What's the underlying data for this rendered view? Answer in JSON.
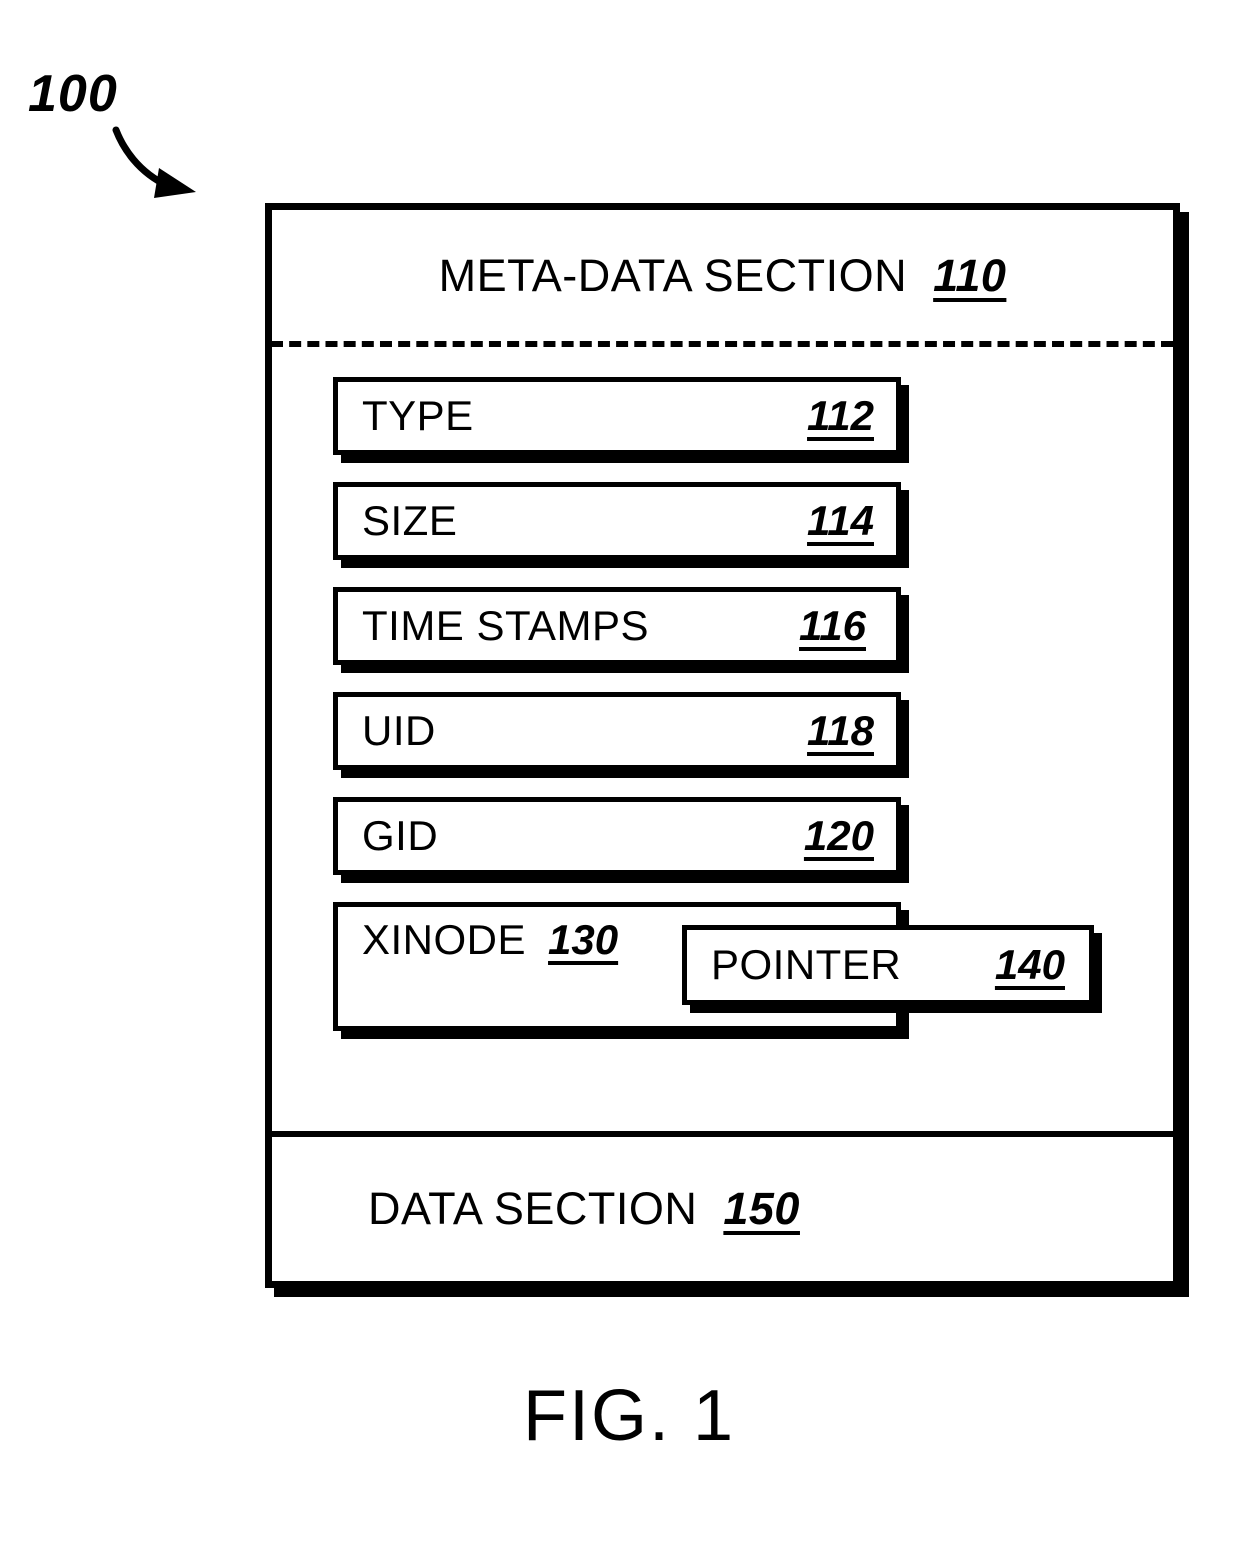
{
  "figure": {
    "callout_ref": "100",
    "caption": "FIG. 1"
  },
  "meta_section": {
    "title": "META-DATA SECTION",
    "ref": "110",
    "fields": [
      {
        "label": "TYPE",
        "ref": "112"
      },
      {
        "label": "SIZE",
        "ref": "114"
      },
      {
        "label": "TIME STAMPS",
        "ref": "116"
      },
      {
        "label": "UID",
        "ref": "118"
      },
      {
        "label": "GID",
        "ref": "120"
      }
    ],
    "xinode": {
      "label": "XINODE",
      "ref": "130",
      "pointer": {
        "label": "POINTER",
        "ref": "140"
      }
    }
  },
  "data_section": {
    "title": "DATA SECTION",
    "ref": "150"
  },
  "colors": {
    "ink": "#000000",
    "paper": "#ffffff"
  }
}
